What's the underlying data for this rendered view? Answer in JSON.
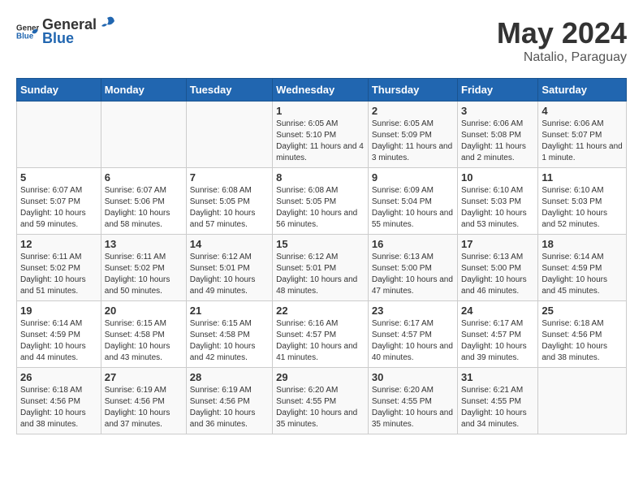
{
  "logo": {
    "general": "General",
    "blue": "Blue"
  },
  "header": {
    "title": "May 2024",
    "subtitle": "Natalio, Paraguay"
  },
  "days_of_week": [
    "Sunday",
    "Monday",
    "Tuesday",
    "Wednesday",
    "Thursday",
    "Friday",
    "Saturday"
  ],
  "weeks": [
    [
      {
        "day": "",
        "info": ""
      },
      {
        "day": "",
        "info": ""
      },
      {
        "day": "",
        "info": ""
      },
      {
        "day": "1",
        "info": "Sunrise: 6:05 AM\nSunset: 5:10 PM\nDaylight: 11 hours and 4 minutes."
      },
      {
        "day": "2",
        "info": "Sunrise: 6:05 AM\nSunset: 5:09 PM\nDaylight: 11 hours and 3 minutes."
      },
      {
        "day": "3",
        "info": "Sunrise: 6:06 AM\nSunset: 5:08 PM\nDaylight: 11 hours and 2 minutes."
      },
      {
        "day": "4",
        "info": "Sunrise: 6:06 AM\nSunset: 5:07 PM\nDaylight: 11 hours and 1 minute."
      }
    ],
    [
      {
        "day": "5",
        "info": "Sunrise: 6:07 AM\nSunset: 5:07 PM\nDaylight: 10 hours and 59 minutes."
      },
      {
        "day": "6",
        "info": "Sunrise: 6:07 AM\nSunset: 5:06 PM\nDaylight: 10 hours and 58 minutes."
      },
      {
        "day": "7",
        "info": "Sunrise: 6:08 AM\nSunset: 5:05 PM\nDaylight: 10 hours and 57 minutes."
      },
      {
        "day": "8",
        "info": "Sunrise: 6:08 AM\nSunset: 5:05 PM\nDaylight: 10 hours and 56 minutes."
      },
      {
        "day": "9",
        "info": "Sunrise: 6:09 AM\nSunset: 5:04 PM\nDaylight: 10 hours and 55 minutes."
      },
      {
        "day": "10",
        "info": "Sunrise: 6:10 AM\nSunset: 5:03 PM\nDaylight: 10 hours and 53 minutes."
      },
      {
        "day": "11",
        "info": "Sunrise: 6:10 AM\nSunset: 5:03 PM\nDaylight: 10 hours and 52 minutes."
      }
    ],
    [
      {
        "day": "12",
        "info": "Sunrise: 6:11 AM\nSunset: 5:02 PM\nDaylight: 10 hours and 51 minutes."
      },
      {
        "day": "13",
        "info": "Sunrise: 6:11 AM\nSunset: 5:02 PM\nDaylight: 10 hours and 50 minutes."
      },
      {
        "day": "14",
        "info": "Sunrise: 6:12 AM\nSunset: 5:01 PM\nDaylight: 10 hours and 49 minutes."
      },
      {
        "day": "15",
        "info": "Sunrise: 6:12 AM\nSunset: 5:01 PM\nDaylight: 10 hours and 48 minutes."
      },
      {
        "day": "16",
        "info": "Sunrise: 6:13 AM\nSunset: 5:00 PM\nDaylight: 10 hours and 47 minutes."
      },
      {
        "day": "17",
        "info": "Sunrise: 6:13 AM\nSunset: 5:00 PM\nDaylight: 10 hours and 46 minutes."
      },
      {
        "day": "18",
        "info": "Sunrise: 6:14 AM\nSunset: 4:59 PM\nDaylight: 10 hours and 45 minutes."
      }
    ],
    [
      {
        "day": "19",
        "info": "Sunrise: 6:14 AM\nSunset: 4:59 PM\nDaylight: 10 hours and 44 minutes."
      },
      {
        "day": "20",
        "info": "Sunrise: 6:15 AM\nSunset: 4:58 PM\nDaylight: 10 hours and 43 minutes."
      },
      {
        "day": "21",
        "info": "Sunrise: 6:15 AM\nSunset: 4:58 PM\nDaylight: 10 hours and 42 minutes."
      },
      {
        "day": "22",
        "info": "Sunrise: 6:16 AM\nSunset: 4:57 PM\nDaylight: 10 hours and 41 minutes."
      },
      {
        "day": "23",
        "info": "Sunrise: 6:17 AM\nSunset: 4:57 PM\nDaylight: 10 hours and 40 minutes."
      },
      {
        "day": "24",
        "info": "Sunrise: 6:17 AM\nSunset: 4:57 PM\nDaylight: 10 hours and 39 minutes."
      },
      {
        "day": "25",
        "info": "Sunrise: 6:18 AM\nSunset: 4:56 PM\nDaylight: 10 hours and 38 minutes."
      }
    ],
    [
      {
        "day": "26",
        "info": "Sunrise: 6:18 AM\nSunset: 4:56 PM\nDaylight: 10 hours and 38 minutes."
      },
      {
        "day": "27",
        "info": "Sunrise: 6:19 AM\nSunset: 4:56 PM\nDaylight: 10 hours and 37 minutes."
      },
      {
        "day": "28",
        "info": "Sunrise: 6:19 AM\nSunset: 4:56 PM\nDaylight: 10 hours and 36 minutes."
      },
      {
        "day": "29",
        "info": "Sunrise: 6:20 AM\nSunset: 4:55 PM\nDaylight: 10 hours and 35 minutes."
      },
      {
        "day": "30",
        "info": "Sunrise: 6:20 AM\nSunset: 4:55 PM\nDaylight: 10 hours and 35 minutes."
      },
      {
        "day": "31",
        "info": "Sunrise: 6:21 AM\nSunset: 4:55 PM\nDaylight: 10 hours and 34 minutes."
      },
      {
        "day": "",
        "info": ""
      }
    ]
  ]
}
